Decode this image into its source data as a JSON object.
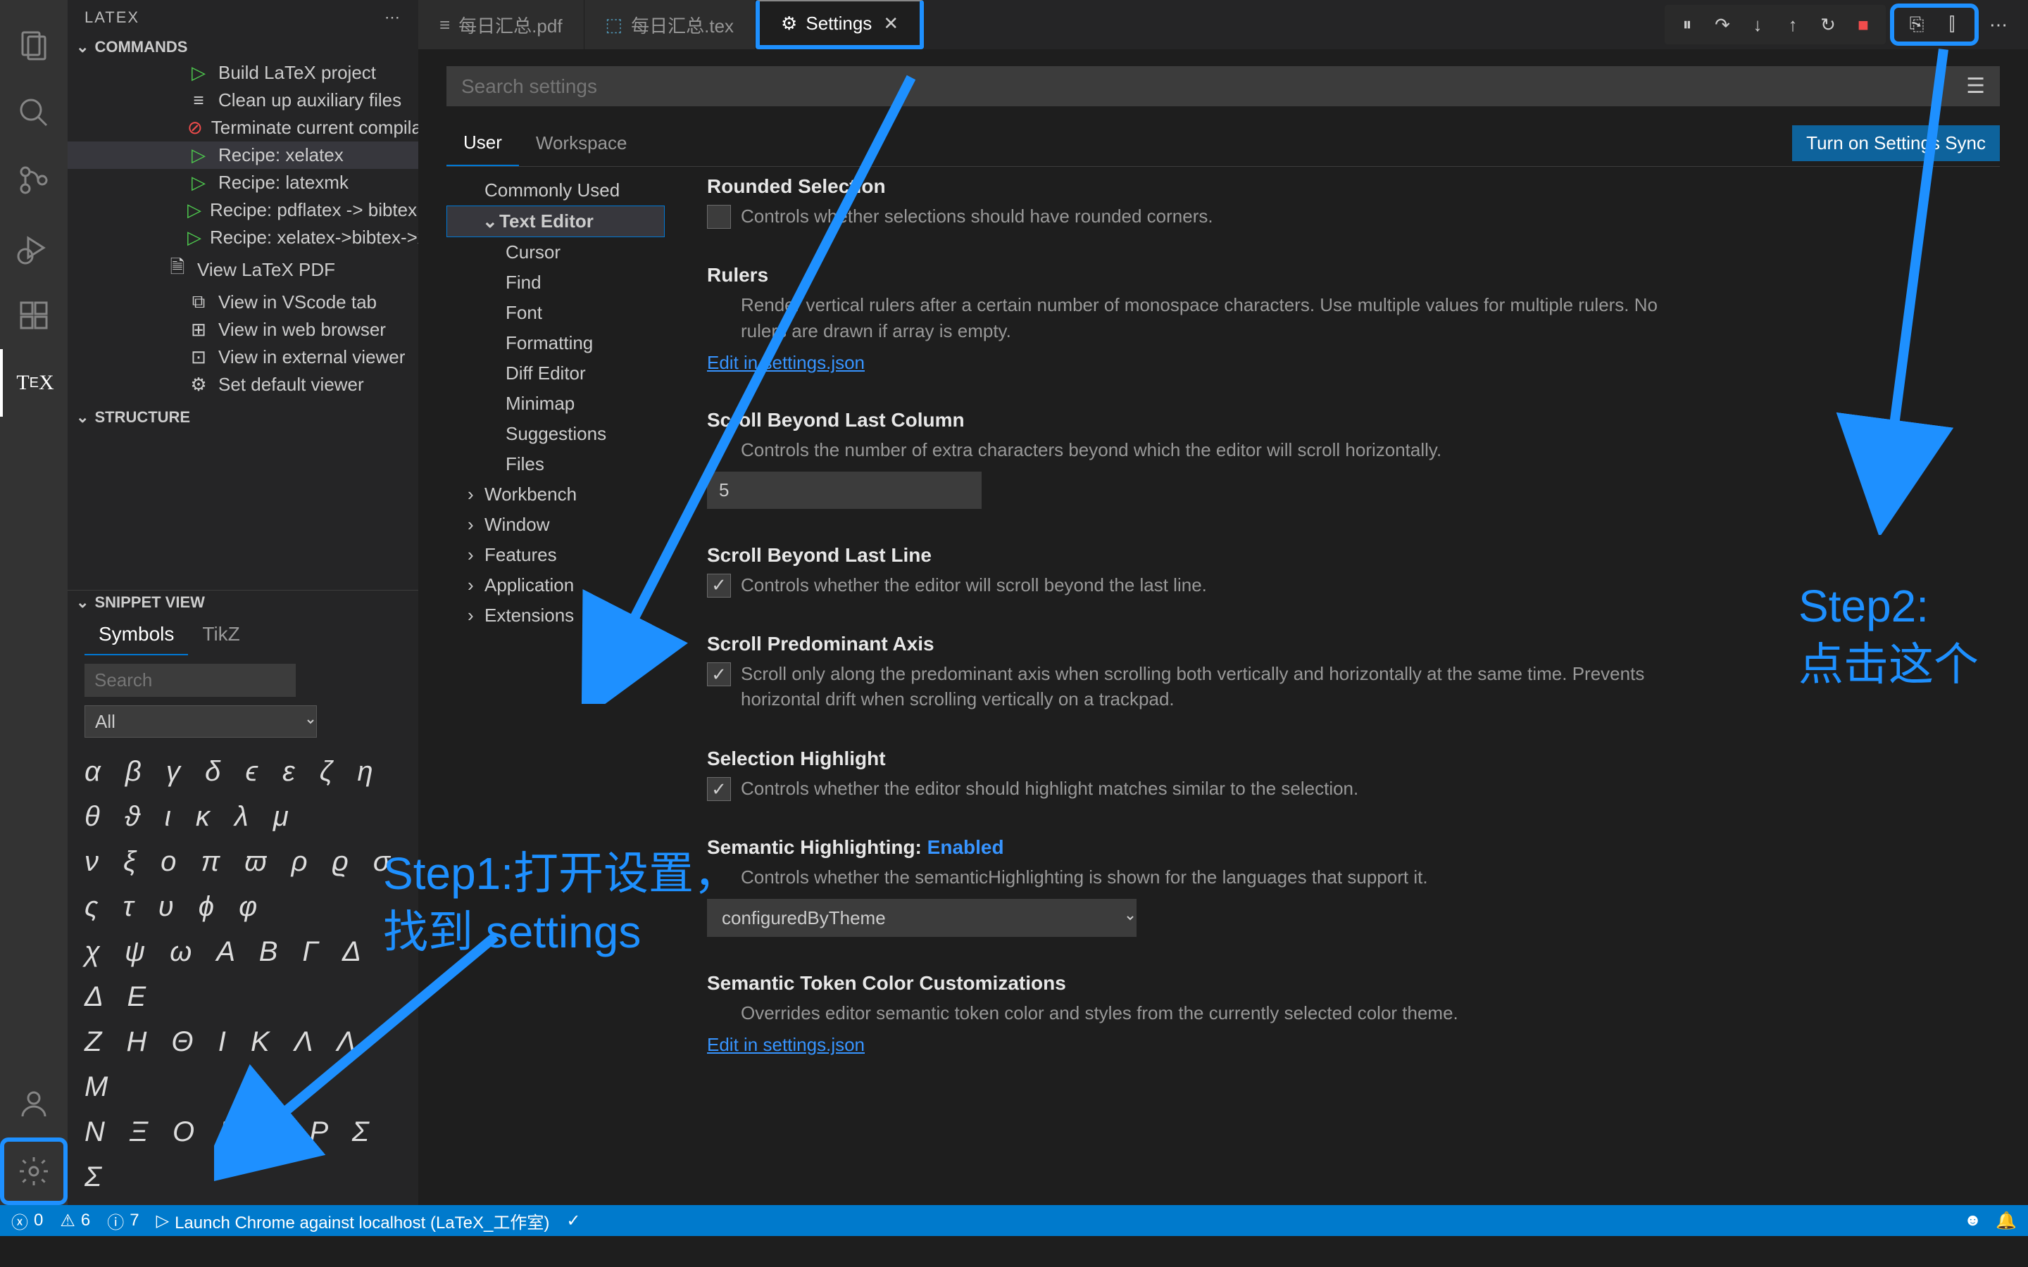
{
  "sidebar": {
    "title": "LATEX",
    "sections": {
      "commands": "COMMANDS",
      "structure": "STRUCTURE",
      "snippet": "SNIPPET VIEW"
    },
    "tree": [
      {
        "label": "Build LaTeX project",
        "icon": "play"
      },
      {
        "label": "Clean up auxiliary files",
        "icon": "trash"
      },
      {
        "label": "Terminate current compilation",
        "icon": "stop"
      },
      {
        "label": "Recipe: xelatex",
        "icon": "play",
        "selected": true
      },
      {
        "label": "Recipe: latexmk",
        "icon": "play"
      },
      {
        "label": "Recipe: pdflatex -> bibtex ->...",
        "icon": "play"
      },
      {
        "label": "Recipe: xelatex->bibtex->xel...",
        "icon": "play"
      },
      {
        "label": "View LaTeX PDF",
        "icon": "pdf",
        "level": 1
      },
      {
        "label": "View in VScode tab",
        "icon": "layout"
      },
      {
        "label": "View in web browser",
        "icon": "browser"
      },
      {
        "label": "View in external viewer",
        "icon": "window"
      },
      {
        "label": "Set default viewer",
        "icon": "gear"
      }
    ],
    "snippet_tabs": [
      "Symbols",
      "TikZ"
    ],
    "snippet_search_placeholder": "Search",
    "snippet_select": "All",
    "greek_rows": [
      "α β γ δ ϵ ε ζ η θ ϑ ι κ λ μ",
      "ν ξ o π ϖ ρ ϱ σ ς τ υ ϕ φ",
      "χ ψ ω A B Γ Δ Δ E",
      "Z H Θ I K Λ Λ M",
      "N Ξ O Π Π P Σ Σ"
    ]
  },
  "tabs": [
    {
      "label": "每日汇总.pdf",
      "icon": "file"
    },
    {
      "label": "每日汇总.tex",
      "icon": "tex"
    },
    {
      "label": "Settings",
      "icon": "gear",
      "active": true,
      "closeable": true
    }
  ],
  "search": {
    "placeholder": "Search settings"
  },
  "scope": {
    "user": "User",
    "workspace": "Workspace",
    "sync": "Turn on Settings Sync"
  },
  "toc": [
    {
      "label": "Commonly Used",
      "cls": "top"
    },
    {
      "label": "Text Editor",
      "cls": "h",
      "chev": "v"
    },
    {
      "label": "Cursor",
      "cls": "sub"
    },
    {
      "label": "Find",
      "cls": "sub"
    },
    {
      "label": "Font",
      "cls": "sub"
    },
    {
      "label": "Formatting",
      "cls": "sub"
    },
    {
      "label": "Diff Editor",
      "cls": "sub"
    },
    {
      "label": "Minimap",
      "cls": "sub"
    },
    {
      "label": "Suggestions",
      "cls": "sub"
    },
    {
      "label": "Files",
      "cls": "sub"
    },
    {
      "label": "Workbench",
      "cls": "cat",
      "chev": ">"
    },
    {
      "label": "Window",
      "cls": "cat",
      "chev": ">"
    },
    {
      "label": "Features",
      "cls": "cat",
      "chev": ">"
    },
    {
      "label": "Application",
      "cls": "cat",
      "chev": ">"
    },
    {
      "label": "Extensions",
      "cls": "cat",
      "chev": ">"
    }
  ],
  "settings": {
    "roundedSelection": {
      "title": "Rounded Selection",
      "desc": "Controls whether selections should have rounded corners."
    },
    "rulers": {
      "title": "Rulers",
      "desc": "Render vertical rulers after a certain number of monospace characters. Use multiple values for multiple rulers. No rulers are drawn if array is empty.",
      "link": "Edit in settings.json"
    },
    "scrollBeyondColumn": {
      "title": "Scroll Beyond Last Column",
      "desc": "Controls the number of extra characters beyond which the editor will scroll horizontally.",
      "value": "5"
    },
    "scrollBeyondLine": {
      "title": "Scroll Beyond Last Line",
      "desc": "Controls whether the editor will scroll beyond the last line."
    },
    "scrollPredominant": {
      "title": "Scroll Predominant Axis",
      "desc": "Scroll only along the predominant axis when scrolling both vertically and horizontally at the same time. Prevents horizontal drift when scrolling vertically on a trackpad."
    },
    "selectionHighlight": {
      "title": "Selection Highlight",
      "desc": "Controls whether the editor should highlight matches similar to the selection."
    },
    "semanticHighlighting": {
      "title": "Semantic Highlighting: ",
      "enabled": "Enabled",
      "desc": "Controls whether the semanticHighlighting is shown for the languages that support it.",
      "value": "configuredByTheme"
    },
    "semanticToken": {
      "title": "Semantic Token Color Customizations",
      "desc": "Overrides editor semantic token color and styles from the currently selected color theme.",
      "link": "Edit in settings.json"
    }
  },
  "annotations": {
    "step1": "Step1:打开设置，\n找到 settings",
    "step2": "Step2:\n点击这个"
  },
  "statusbar": {
    "errors": "0",
    "warnings": "6",
    "info": "7",
    "launch": "Launch Chrome against localhost (LaTeX_工作室)"
  }
}
